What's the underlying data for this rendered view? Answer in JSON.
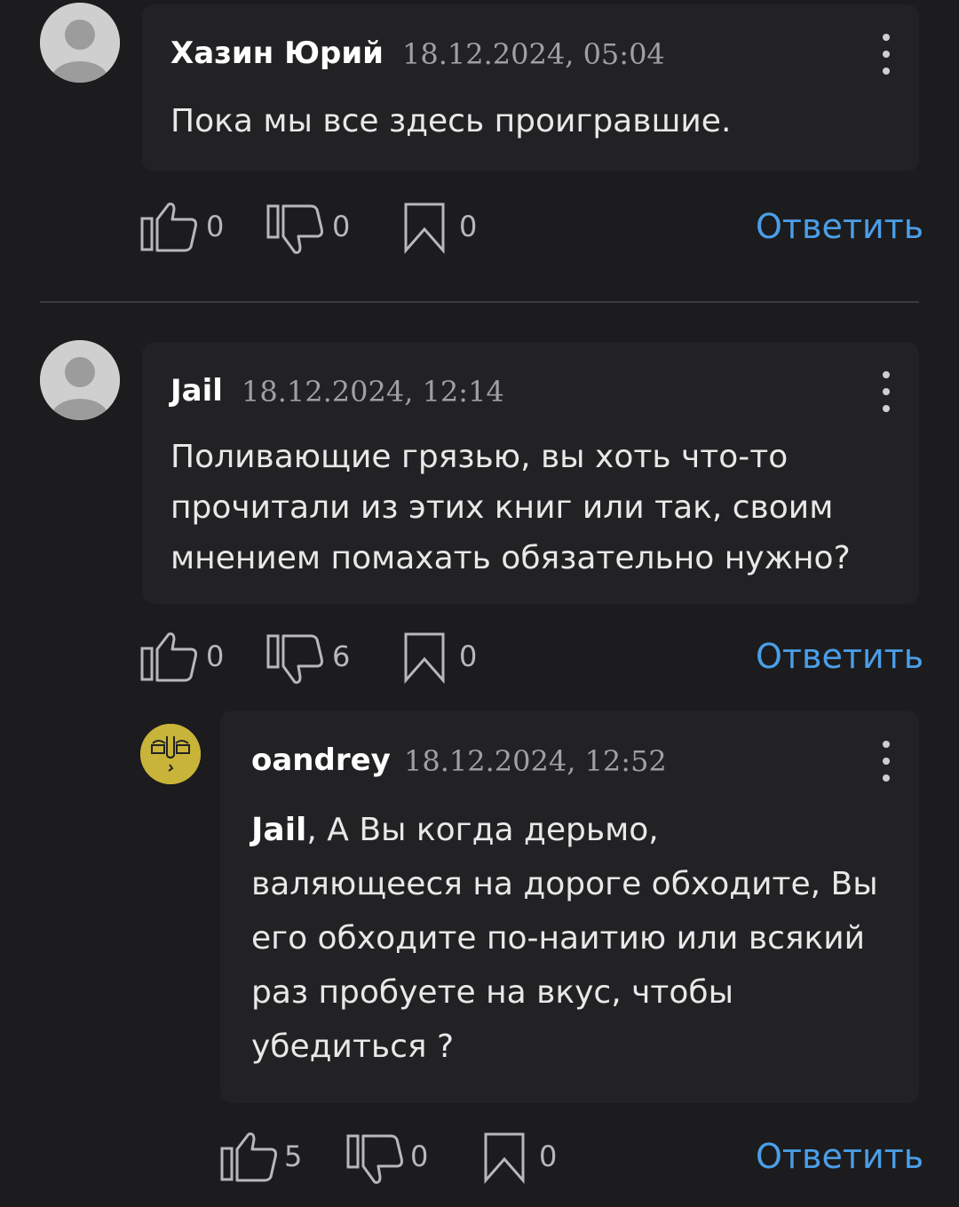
{
  "reply_label": "Ответить",
  "comments": [
    {
      "author": "Хазин Юрий",
      "timestamp": "18.12.2024, 05:04",
      "text": "Пока мы все здесь проигравшие.",
      "likes": "0",
      "dislikes": "0",
      "bookmarks": "0"
    },
    {
      "author": "Jail",
      "timestamp": "18.12.2024, 12:14",
      "text_lines": [
        "Поливающие грязью, вы хоть что-то",
        "прочитали из этих книг или так, своим",
        "мнением помахать обязательно нужно?"
      ],
      "likes": "0",
      "dislikes": "6",
      "bookmarks": "0"
    },
    {
      "author": "oandrey",
      "timestamp": "18.12.2024, 12:52",
      "mention": "Jail",
      "text_first": ", А Вы когда дерьмо,",
      "text_lines": [
        "валяющееся на дороге обходите, Вы",
        "его обходите по-наитию или всякий",
        "раз пробуете на вкус, чтобы",
        "убедиться ?"
      ],
      "likes": "5",
      "dislikes": "0",
      "bookmarks": "0"
    }
  ],
  "colors": {
    "background": "#1c1c1e",
    "bubble": "#222224",
    "link": "#4a9fe8",
    "avatar_gold": "#c9b43a"
  },
  "icons": [
    "user-placeholder-icon",
    "kebab-menu-icon",
    "thumbs-up-icon",
    "thumbs-down-icon",
    "bookmark-icon"
  ]
}
